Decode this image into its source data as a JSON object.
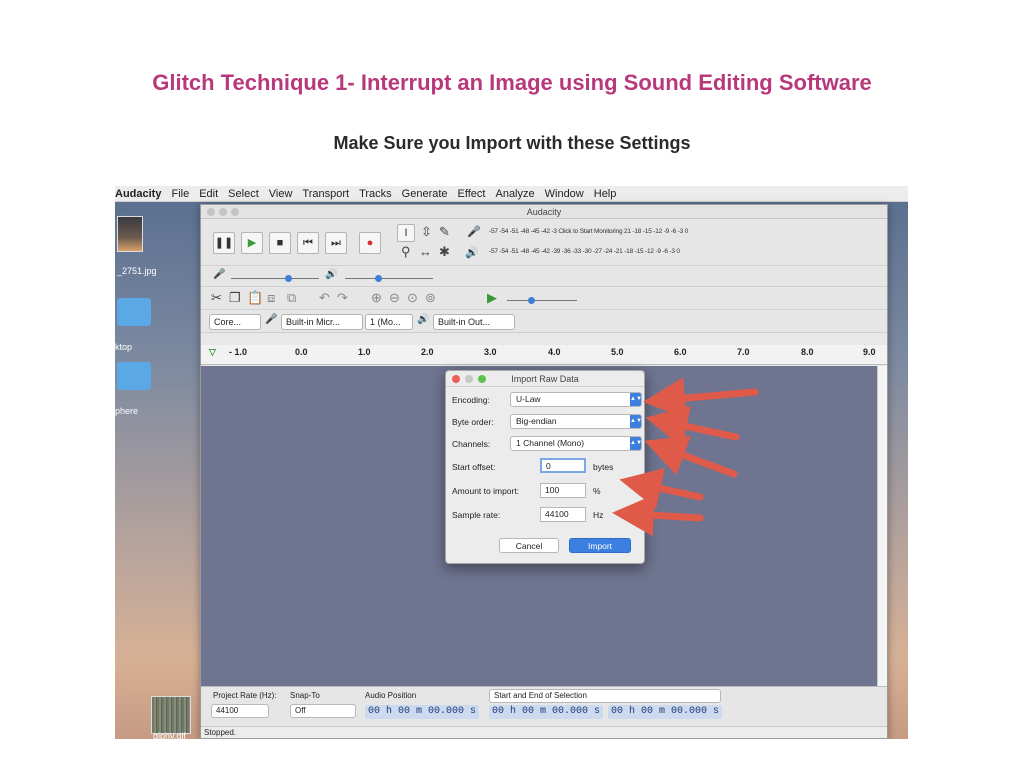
{
  "slide": {
    "title": "Glitch Technique 1- Interrupt an Image using Sound Editing Software",
    "subtitle": "Make Sure you Import with these Settings"
  },
  "menubar": {
    "items": [
      "Audacity",
      "File",
      "Edit",
      "Select",
      "View",
      "Transport",
      "Tracks",
      "Generate",
      "Effect",
      "Analyze",
      "Window",
      "Help"
    ]
  },
  "desktop": {
    "image_file": "_2751.jpg",
    "folder1": "ktop",
    "folder2": "phere",
    "gif_file": "giphy.gif"
  },
  "window": {
    "title": "Audacity",
    "meter_record": "-57 -54 -51 -48 -45 -42 -3 Click to Start Monitoring 21 -18 -15 -12 -9 -6 -3 0",
    "meter_play": "-57 -54 -51 -48 -45 -42 -39 -36 -33 -30 -27 -24 -21 -18 -15 -12 -9 -6 -3 0",
    "devices": {
      "host": "Core...",
      "input": "Built-in Micr...",
      "channels": "1 (Mo...",
      "output": "Built-in Out..."
    },
    "ruler": [
      "- 1.0",
      "0.0",
      "1.0",
      "2.0",
      "3.0",
      "4.0",
      "5.0",
      "6.0",
      "7.0",
      "8.0",
      "9.0"
    ]
  },
  "selection_bar": {
    "project_rate_label": "Project Rate (Hz):",
    "project_rate_value": "44100",
    "snap_to_label": "Snap-To",
    "snap_to_value": "Off",
    "audio_position_label": "Audio Position",
    "selection_mode": "Start and End of Selection",
    "time1": "00 h 00 m 00.000 s",
    "time2": "00 h 00 m 00.000 s",
    "time3": "00 h 00 m 00.000 s",
    "status": "Stopped."
  },
  "dialog": {
    "title": "Import Raw Data",
    "encoding_label": "Encoding:",
    "encoding_value": "U-Law",
    "byte_order_label": "Byte order:",
    "byte_order_value": "Big-endian",
    "channels_label": "Channels:",
    "channels_value": "1 Channel (Mono)",
    "start_offset_label": "Start offset:",
    "start_offset_value": "0",
    "start_offset_unit": "bytes",
    "amount_label": "Amount to import:",
    "amount_value": "100",
    "amount_unit": "%",
    "sample_rate_label": "Sample rate:",
    "sample_rate_value": "44100",
    "sample_rate_unit": "Hz",
    "cancel_label": "Cancel",
    "import_label": "Import"
  },
  "colors": {
    "title": "#b8397b",
    "arrow": "#e05a4a",
    "accent": "#3b80e0"
  }
}
